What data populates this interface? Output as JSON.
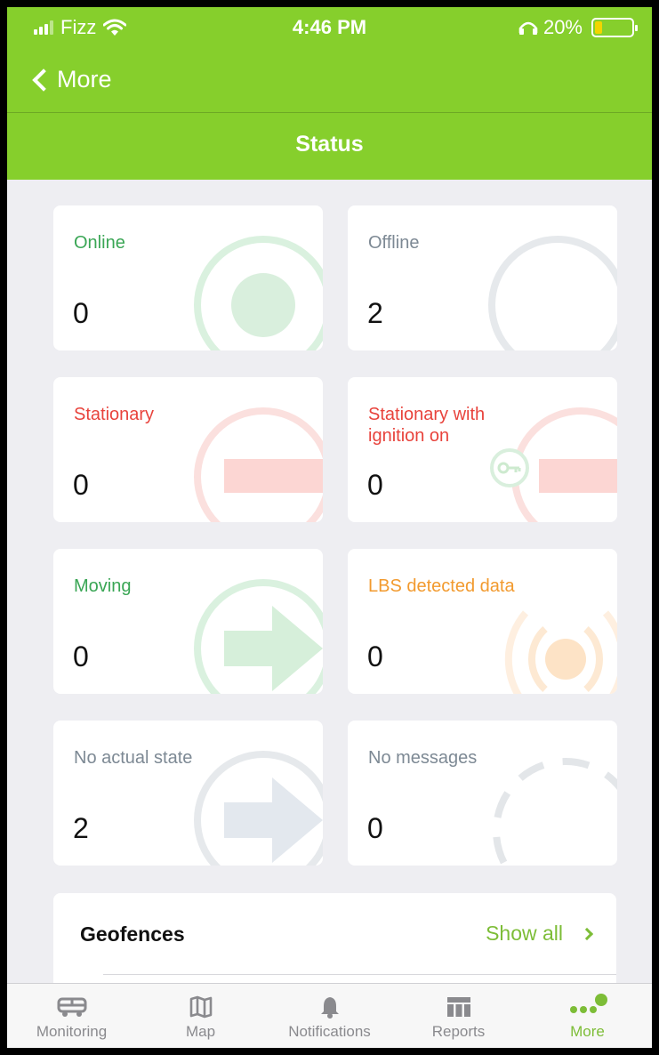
{
  "status_bar": {
    "carrier": "Fizz",
    "time": "4:46 PM",
    "battery_percent": "20%",
    "battery_level": 0.2
  },
  "nav": {
    "back_label": "More",
    "title": "Status"
  },
  "tiles": [
    {
      "label": "Online",
      "count": "0",
      "color": "#3aa655",
      "icon": "online-icon"
    },
    {
      "label": "Offline",
      "count": "2",
      "color": "#7d8994",
      "icon": "offline-icon"
    },
    {
      "label": "Stationary",
      "count": "0",
      "color": "#e8433c",
      "icon": "stationary-icon"
    },
    {
      "label": "Stationary with ignition on",
      "count": "0",
      "color": "#e8433c",
      "icon": "ignition-key-icon"
    },
    {
      "label": "Moving",
      "count": "0",
      "color": "#3aa655",
      "icon": "moving-arrow-icon"
    },
    {
      "label": "LBS detected data",
      "count": "0",
      "color": "#f29a2e",
      "icon": "lbs-signal-icon"
    },
    {
      "label": "No actual state",
      "count": "2",
      "color": "#7d8994",
      "icon": "no-state-arrow-icon"
    },
    {
      "label": "No messages",
      "count": "0",
      "color": "#7d8994",
      "icon": "no-messages-icon"
    }
  ],
  "geofences": {
    "title": "Geofences",
    "show_all": "Show all"
  },
  "tabbar": {
    "items": [
      {
        "label": "Monitoring",
        "icon": "car-icon",
        "active": false
      },
      {
        "label": "Map",
        "icon": "map-icon",
        "active": false
      },
      {
        "label": "Notifications",
        "icon": "bell-icon",
        "active": false
      },
      {
        "label": "Reports",
        "icon": "reports-table-icon",
        "active": false
      },
      {
        "label": "More",
        "icon": "more-dots-icon",
        "active": true
      }
    ]
  },
  "colors": {
    "accent": "#86cf2c",
    "link": "#7dbd37",
    "background": "#eeeef2"
  }
}
